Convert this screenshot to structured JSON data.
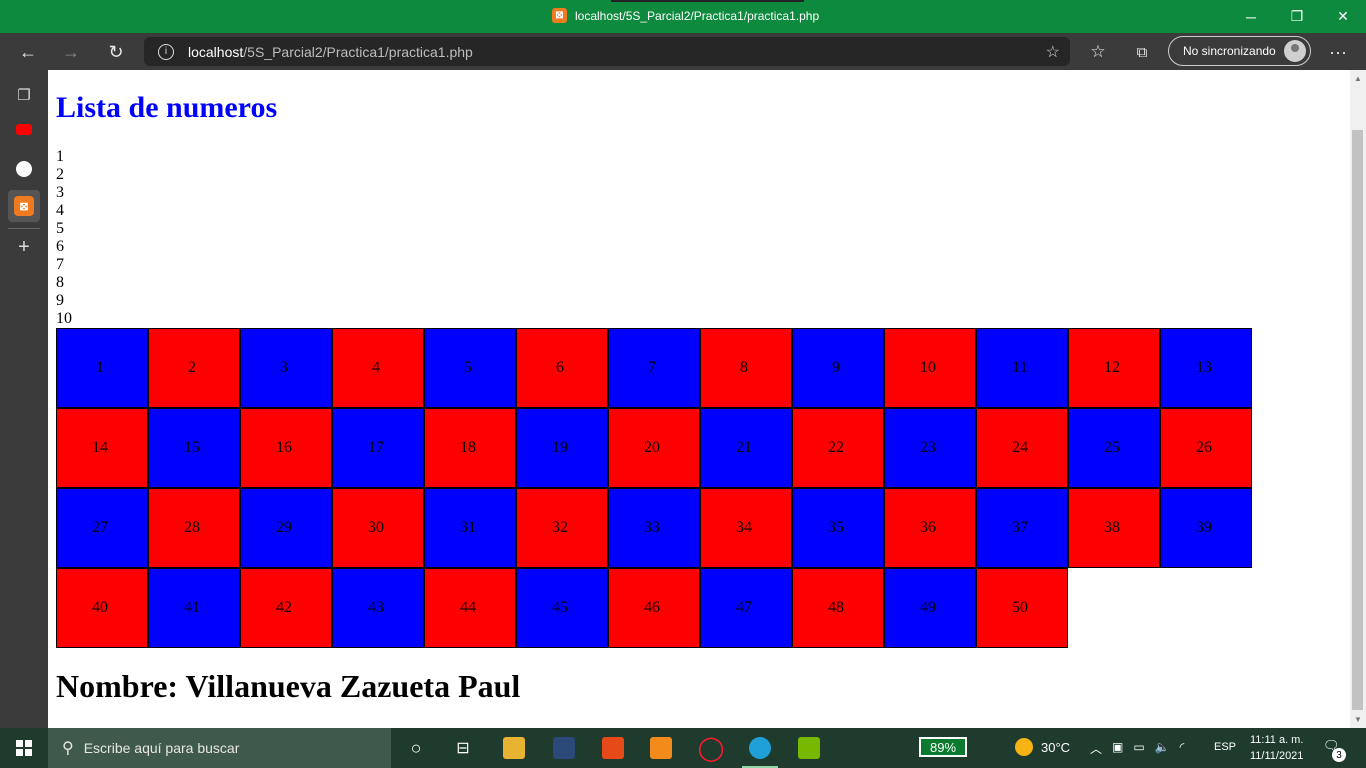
{
  "window": {
    "title": "localhost/5S_Parcial2/Practica1/practica1.php",
    "minimize": "─",
    "maximize": "❐",
    "close": "✕"
  },
  "toolbar": {
    "url_host": "localhost",
    "url_path": "/5S_Parcial2/Practica1/practica1.php",
    "sync_label": "No sincronizando"
  },
  "page": {
    "title": "Lista de numeros",
    "numbers": [
      "1",
      "2",
      "3",
      "4",
      "5",
      "6",
      "7",
      "8",
      "9",
      "10"
    ],
    "cells": [
      {
        "n": "1",
        "color": "blue"
      },
      {
        "n": "2",
        "color": "red"
      },
      {
        "n": "3",
        "color": "blue"
      },
      {
        "n": "4",
        "color": "red"
      },
      {
        "n": "5",
        "color": "blue"
      },
      {
        "n": "6",
        "color": "red"
      },
      {
        "n": "7",
        "color": "blue"
      },
      {
        "n": "8",
        "color": "red"
      },
      {
        "n": "9",
        "color": "blue"
      },
      {
        "n": "10",
        "color": "red"
      },
      {
        "n": "11",
        "color": "blue"
      },
      {
        "n": "12",
        "color": "red"
      },
      {
        "n": "13",
        "color": "blue"
      },
      {
        "n": "14",
        "color": "red"
      },
      {
        "n": "15",
        "color": "blue"
      },
      {
        "n": "16",
        "color": "red"
      },
      {
        "n": "17",
        "color": "blue"
      },
      {
        "n": "18",
        "color": "red"
      },
      {
        "n": "19",
        "color": "blue"
      },
      {
        "n": "20",
        "color": "red"
      },
      {
        "n": "21",
        "color": "blue"
      },
      {
        "n": "22",
        "color": "red"
      },
      {
        "n": "23",
        "color": "blue"
      },
      {
        "n": "24",
        "color": "red"
      },
      {
        "n": "25",
        "color": "blue"
      },
      {
        "n": "26",
        "color": "red"
      },
      {
        "n": "27",
        "color": "blue"
      },
      {
        "n": "28",
        "color": "red"
      },
      {
        "n": "29",
        "color": "blue"
      },
      {
        "n": "30",
        "color": "red"
      },
      {
        "n": "31",
        "color": "blue"
      },
      {
        "n": "32",
        "color": "red"
      },
      {
        "n": "33",
        "color": "blue"
      },
      {
        "n": "34",
        "color": "red"
      },
      {
        "n": "35",
        "color": "blue"
      },
      {
        "n": "36",
        "color": "red"
      },
      {
        "n": "37",
        "color": "blue"
      },
      {
        "n": "38",
        "color": "red"
      },
      {
        "n": "39",
        "color": "blue"
      },
      {
        "n": "40",
        "color": "red"
      },
      {
        "n": "41",
        "color": "blue"
      },
      {
        "n": "42",
        "color": "red"
      },
      {
        "n": "43",
        "color": "blue"
      },
      {
        "n": "44",
        "color": "red"
      },
      {
        "n": "45",
        "color": "blue"
      },
      {
        "n": "46",
        "color": "red"
      },
      {
        "n": "47",
        "color": "blue"
      },
      {
        "n": "48",
        "color": "red"
      },
      {
        "n": "49",
        "color": "blue"
      },
      {
        "n": "50",
        "color": "red"
      }
    ],
    "name": "Nombre: Villanueva Zazueta Paul"
  },
  "taskbar": {
    "search_placeholder": "Escribe aquí para buscar",
    "battery": "89%",
    "temperature": "30°C",
    "language": "ESP",
    "time": "11:11 a. m.",
    "date": "11/11/2021",
    "notifications": "3"
  },
  "colors": {
    "blue": "#0000ff",
    "red": "#ff0000",
    "title_blue": "#0000ff",
    "titlebar_green": "#0e8a3e"
  }
}
